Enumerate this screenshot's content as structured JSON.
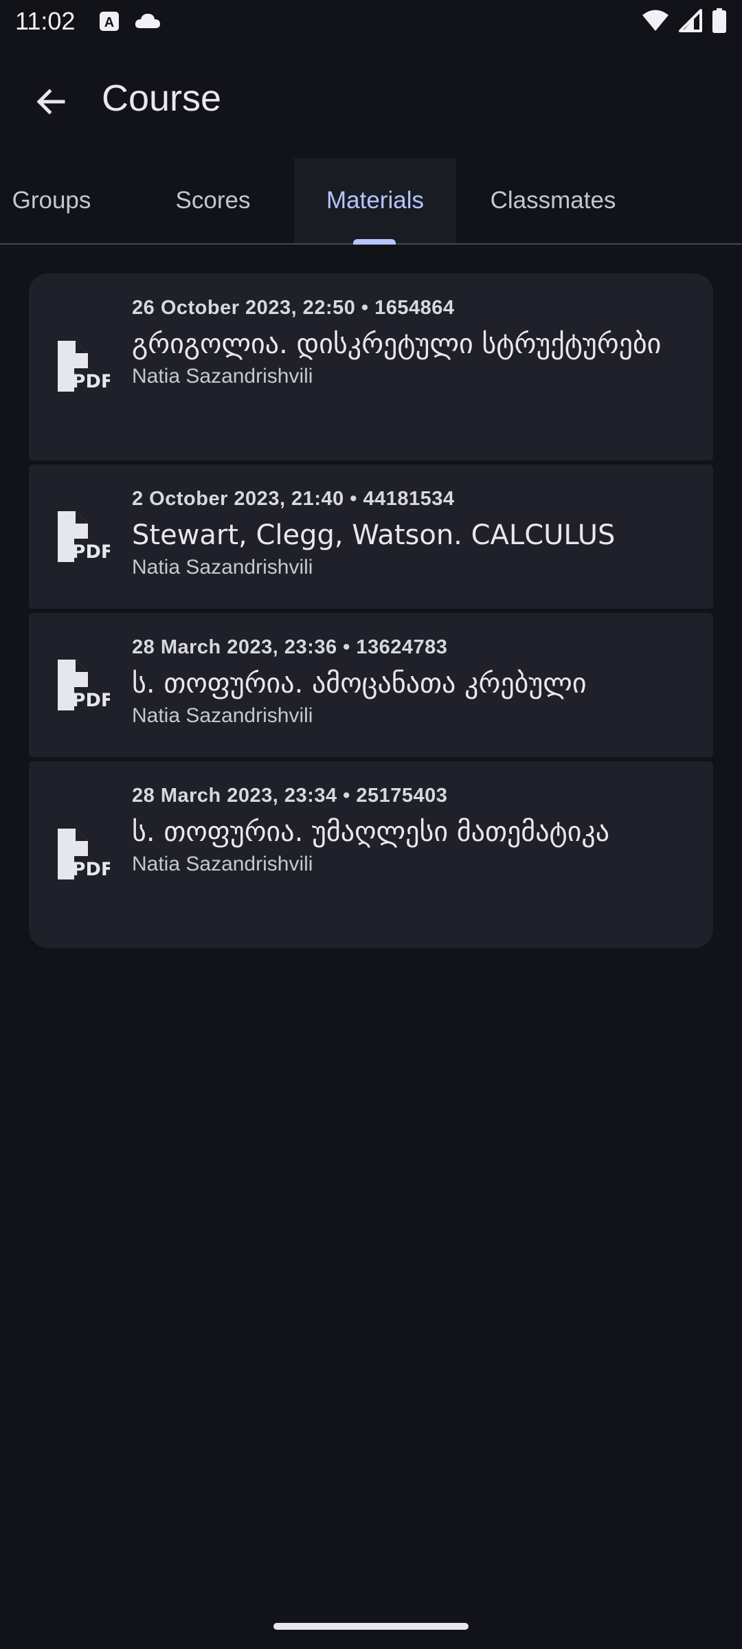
{
  "status_bar": {
    "time": "11:02",
    "icons": [
      "a-notification-icon",
      "cloud-icon",
      "wifi-icon",
      "signal-icon",
      "battery-icon"
    ]
  },
  "app_bar": {
    "title": "Course",
    "back_icon": "arrow-back-icon"
  },
  "tabs": [
    {
      "label": "Groups",
      "active": false
    },
    {
      "label": "Scores",
      "active": false
    },
    {
      "label": "Materials",
      "active": true
    },
    {
      "label": "Classmates",
      "active": false
    }
  ],
  "materials": [
    {
      "meta": "26 October 2023, 22:50 • 1654864",
      "title": "გრიგოლია. დისკრეტული სტრუქტურები",
      "author": "Natia Sazandrishvili",
      "icon": "pdf-file-icon"
    },
    {
      "meta": "2 October 2023, 21:40 • 44181534",
      "title": "Stewart, Clegg, Watson. CALCULUS",
      "author": "Natia Sazandrishvili",
      "icon": "pdf-file-icon"
    },
    {
      "meta": "28 March 2023, 23:36 • 13624783",
      "title": "ს. თოფურია. ამოცანათა კრებული",
      "author": "Natia Sazandrishvili",
      "icon": "pdf-file-icon"
    },
    {
      "meta": "28 March 2023, 23:34 • 25175403",
      "title": "ს. თოფურია. უმაღლესი მათემატიკა",
      "author": "Natia Sazandrishvili",
      "icon": "pdf-file-icon"
    }
  ],
  "colors": {
    "background": "#121319",
    "card": "#1f2029",
    "accent": "#b7c4ff",
    "text": "#e3e2e9"
  }
}
